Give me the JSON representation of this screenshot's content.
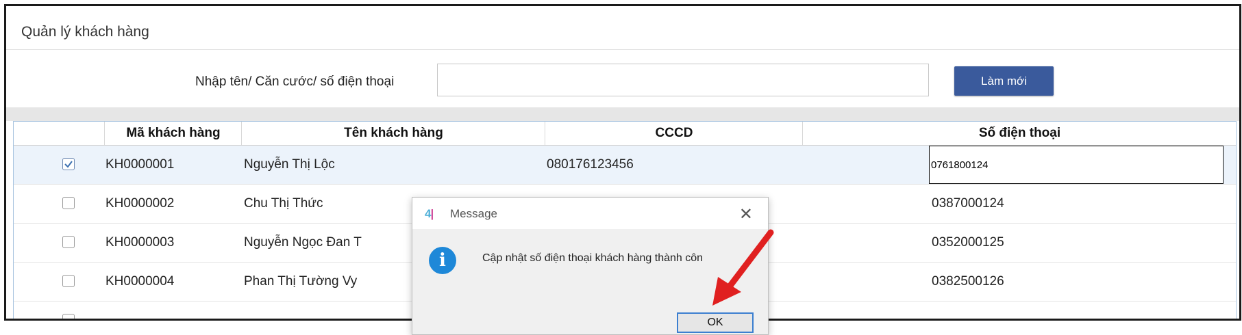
{
  "window": {
    "title": "Quản lý khách hàng"
  },
  "search": {
    "label": "Nhập tên/ Căn cước/ số điện thoại",
    "value": "",
    "placeholder": ""
  },
  "toolbar": {
    "refresh_label": "Làm mới"
  },
  "table": {
    "columns": [
      "",
      "Mã khách hàng",
      "Tên khách hàng",
      "CCCD",
      "Số điện thoại"
    ],
    "rows": [
      {
        "checked": true,
        "id": "KH0000001",
        "name": "Nguyễn Thị Lộc",
        "cccd": "080176123456",
        "phone": "0761800124"
      },
      {
        "checked": false,
        "id": "KH0000002",
        "name": "Chu Thị Thức",
        "cccd": "",
        "phone": "0387000124"
      },
      {
        "checked": false,
        "id": "KH0000003",
        "name": "Nguyễn Ngọc Đan T",
        "cccd": "",
        "phone": "0352000125"
      },
      {
        "checked": false,
        "id": "KH0000004",
        "name": "Phan Thị Tường Vy",
        "cccd": "",
        "phone": "0382500126"
      }
    ]
  },
  "dialog": {
    "title": "Message",
    "message": "Cập nhật số điện thoại khách hàng thành côn",
    "ok_label": "OK",
    "icon": "info-icon",
    "close_icon": "close-icon"
  },
  "colors": {
    "accent": "#3a5a9c",
    "info": "#1e88d8",
    "arrow": "#e02020"
  }
}
